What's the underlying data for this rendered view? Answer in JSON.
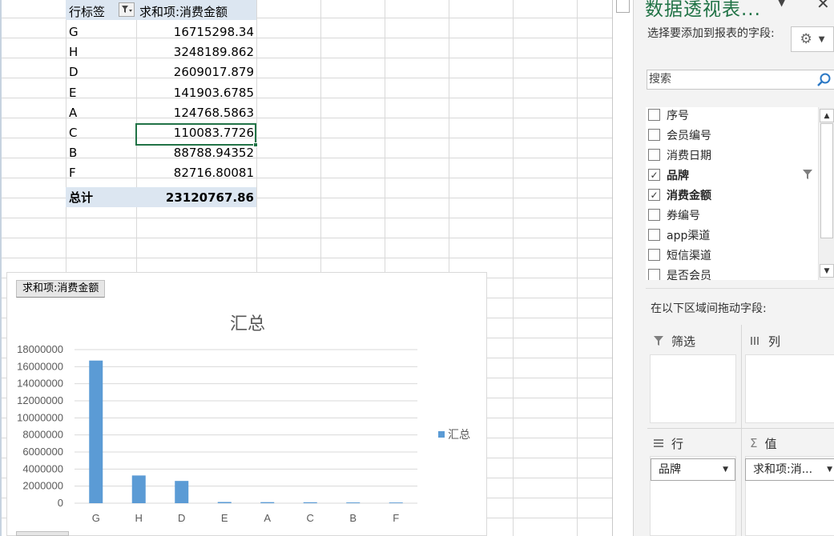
{
  "pivot": {
    "header_label": "行标签",
    "header_value": "求和项:消费金额",
    "rows": [
      {
        "label": "G",
        "value": "16715298.34"
      },
      {
        "label": "H",
        "value": "3248189.862"
      },
      {
        "label": "D",
        "value": "2609017.879"
      },
      {
        "label": "E",
        "value": "141903.6785"
      },
      {
        "label": "A",
        "value": "124768.5863"
      },
      {
        "label": "C",
        "value": "110083.7726"
      },
      {
        "label": "B",
        "value": "88788.94352"
      },
      {
        "label": "F",
        "value": "82716.80081"
      }
    ],
    "total_label": "总计",
    "total_value": "23120767.86"
  },
  "chart": {
    "field_button": "求和项:消费金额",
    "legend_label": "汇总",
    "colors": {
      "series": "#5b9bd5",
      "grid": "#d9d9d9",
      "text": "#595959"
    }
  },
  "chart_data": {
    "type": "bar",
    "title": "汇总",
    "categories": [
      "G",
      "H",
      "D",
      "E",
      "A",
      "C",
      "B",
      "F"
    ],
    "series": [
      {
        "name": "汇总",
        "values": [
          16715298.34,
          3248189.862,
          2609017.879,
          141903.6785,
          124768.5863,
          110083.7726,
          88788.94352,
          82716.80081
        ]
      }
    ],
    "ylim": [
      0,
      18000000
    ],
    "yticks": [
      0,
      2000000,
      4000000,
      6000000,
      8000000,
      10000000,
      12000000,
      14000000,
      16000000,
      18000000
    ],
    "ytick_labels": [
      "0",
      "2000000",
      "4000000",
      "6000000",
      "8000000",
      "10000000",
      "12000000",
      "14000000",
      "16000000",
      "18000000"
    ],
    "grid": true,
    "legend_position": "right"
  },
  "pane": {
    "title": "数据透视表...",
    "subtitle": "选择要添加到报表的字段:",
    "search_placeholder": "搜索",
    "fields": [
      {
        "label": "序号",
        "checked": false
      },
      {
        "label": "会员编号",
        "checked": false
      },
      {
        "label": "消费日期",
        "checked": false
      },
      {
        "label": "品牌",
        "checked": true
      },
      {
        "label": "消费金额",
        "checked": true
      },
      {
        "label": "券编号",
        "checked": false
      },
      {
        "label": "app渠道",
        "checked": false
      },
      {
        "label": "短信渠道",
        "checked": false
      },
      {
        "label": "是否会员",
        "checked": false
      }
    ],
    "drag_hint": "在以下区域间拖动字段:",
    "areas": {
      "filter": "筛选",
      "columns": "列",
      "rows": "行",
      "values": "值"
    },
    "row_pill": "品牌",
    "value_pill": "求和项:消..."
  },
  "icons": {
    "gear": "gear-icon",
    "search": "search-icon",
    "close": "close-icon",
    "filter": "filter-icon"
  }
}
